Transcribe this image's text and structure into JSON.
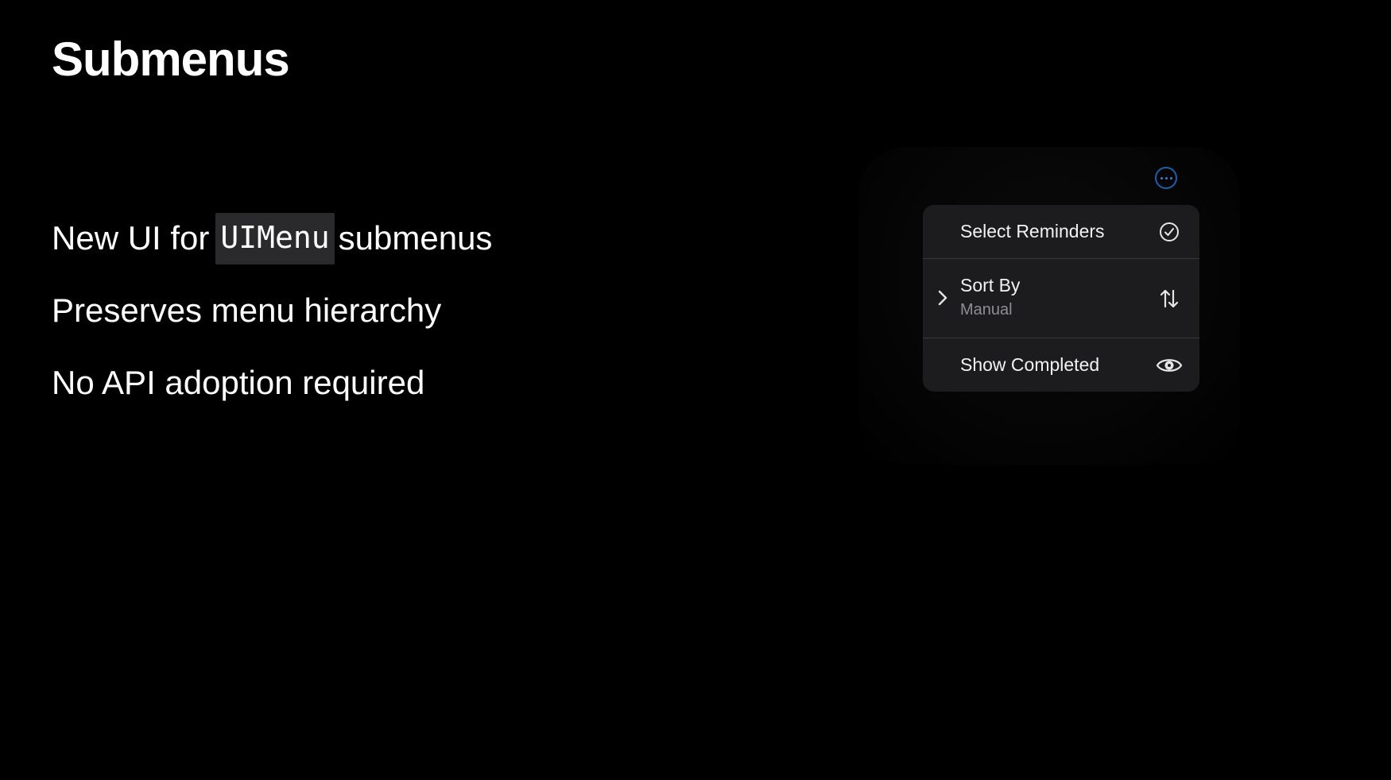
{
  "slide": {
    "title": "Submenus",
    "bullets": {
      "b1_prefix": "New UI for",
      "b1_code": "UIMenu",
      "b1_suffix": "submenus",
      "b2": "Preserves menu hierarchy",
      "b3": "No API adoption required"
    }
  },
  "demo": {
    "more_button_icon": "ellipsis-circle-icon",
    "accent_color": "#1f5fa8",
    "menu": {
      "items": [
        {
          "label": "Select Reminders",
          "icon": "checkmark-circle-icon"
        },
        {
          "label": "Sort By",
          "subtitle": "Manual",
          "icon": "arrow-up-arrow-down-icon",
          "chevron": "chevron-right-icon"
        },
        {
          "label": "Show Completed",
          "icon": "eye-icon"
        }
      ]
    }
  }
}
